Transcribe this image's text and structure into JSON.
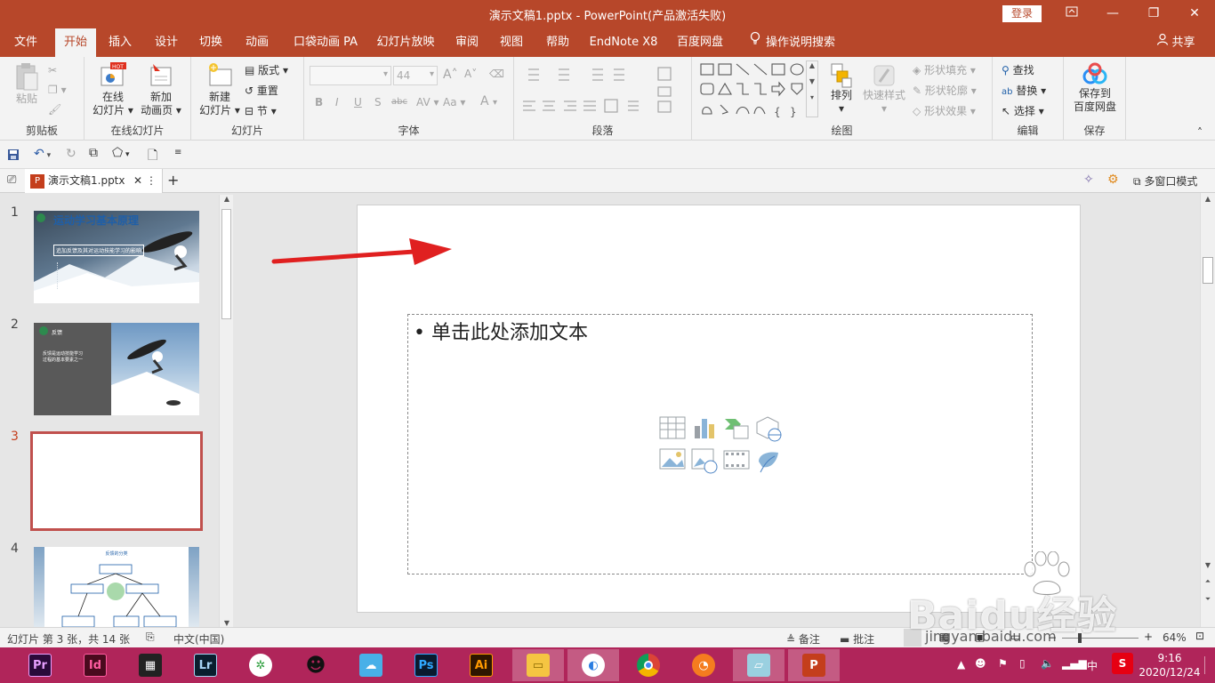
{
  "window": {
    "title": "演示文稿1.pptx  -  PowerPoint(产品激活失败)",
    "login": "登录",
    "minimize": "—",
    "restore": "❐",
    "close": "✕"
  },
  "menu_tabs": [
    "文件",
    "开始",
    "插入",
    "设计",
    "切换",
    "动画",
    "口袋动画 PA",
    "幻灯片放映",
    "审阅",
    "视图",
    "帮助",
    "EndNote X8",
    "百度网盘",
    "操作说明搜索"
  ],
  "active_tab": "开始",
  "share": "共享",
  "ribbon": {
    "clipboard": {
      "label": "剪贴板",
      "paste": "粘贴"
    },
    "online": {
      "label": "在线幻灯片",
      "online_slide": [
        "在线",
        "幻灯片"
      ],
      "new_anim": [
        "新加",
        "动画页"
      ],
      "hot": "HOT"
    },
    "slides": {
      "label": "幻灯片",
      "new_slide": [
        "新建",
        "幻灯片"
      ],
      "layout": "版式",
      "reset": "重置",
      "section": "节"
    },
    "font": {
      "label": "字体",
      "size": "44",
      "bold": "B",
      "italic": "I",
      "underline": "U",
      "shadow": "S",
      "strike": "abc",
      "spacing": "AV",
      "case": "Aa",
      "color": "A",
      "grow": "A",
      "shrink": "A"
    },
    "paragraph": {
      "label": "段落"
    },
    "drawing": {
      "label": "绘图",
      "arrange": "排列",
      "quick_styles": "快速样式",
      "fill": "形状填充",
      "outline": "形状轮廓",
      "effects": "形状效果"
    },
    "editing": {
      "label": "编辑",
      "find": "查找",
      "replace": "替换",
      "select": "选择"
    },
    "save": {
      "label": "保存",
      "save_to": [
        "保存到",
        "百度网盘"
      ]
    }
  },
  "doc_tab": {
    "name": "演示文稿1.pptx",
    "multi_window": "多窗口模式"
  },
  "slides": [
    {
      "num": "1",
      "title": "运动学习基本原理",
      "subtitle": "追加反馈及其对运动技能学习的影响"
    },
    {
      "num": "2",
      "title": "反馈",
      "text": [
        "反馈是运动技能学习",
        "过程的基本要素之一"
      ]
    },
    {
      "num": "3",
      "selected": true
    },
    {
      "num": "4",
      "title": "反馈的分类"
    }
  ],
  "main_slide": {
    "placeholder_text": "单击此处添加文本"
  },
  "status": {
    "slide_info": "幻灯片 第 3 张，共 14 张",
    "language": "中文(中国)",
    "notes": "备注",
    "comments": "批注",
    "zoom": "64%"
  },
  "taskbar": {
    "apps": [
      "Pr",
      "Id",
      "Lr",
      "Ps",
      "Ai"
    ],
    "time": "9:16",
    "date": "2020/12/24",
    "ime": "中"
  },
  "watermark": {
    "brand": "Baidu经验",
    "url": "jingyan.baidu.com"
  },
  "colors": {
    "accent": "#b7472a",
    "taskbar": "#b0255a",
    "arrow": "#e02020"
  }
}
